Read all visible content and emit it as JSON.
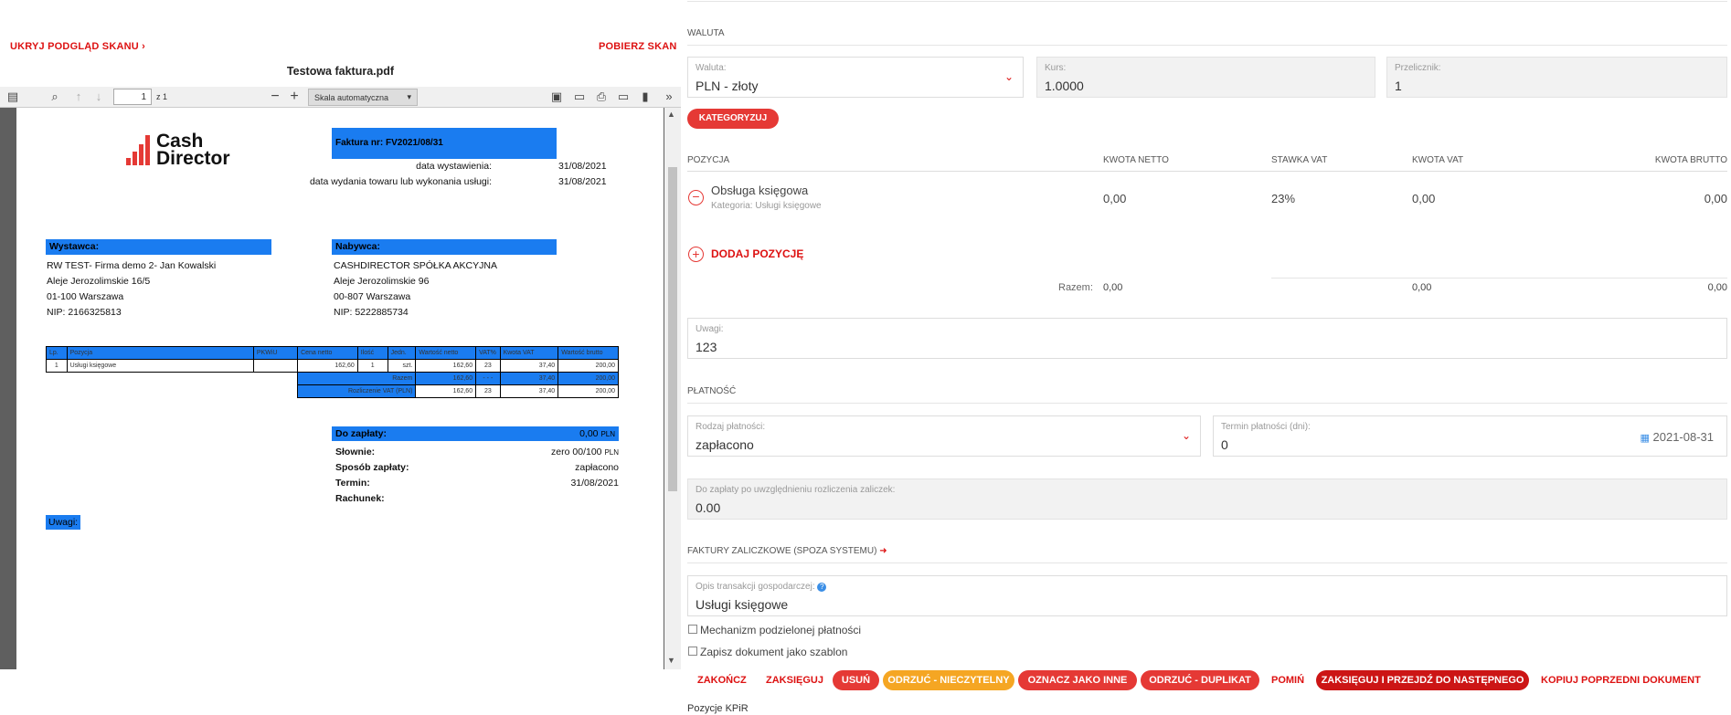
{
  "left": {
    "hide_scan": "UKRYJ PODGLĄD SKANU",
    "download_scan": "POBIERZ SKAN",
    "pdf_title": "Testowa faktura.pdf",
    "toolbar": {
      "page_current": "1",
      "page_total": "z 1",
      "zoom": "Skala automatyczna"
    }
  },
  "invoice": {
    "logo_line1": "Cash",
    "logo_line2": "Director",
    "number": "Faktura nr: FV2021/08/31",
    "issue_label": "data wystawienia:",
    "issue_date": "31/08/2021",
    "delivery_label": "data wydania towaru lub wykonania usługi:",
    "delivery_date": "31/08/2021",
    "seller_header": "Wystawca:",
    "seller": [
      "RW TEST- Firma demo 2- Jan Kowalski",
      "Aleje Jerozolimskie 16/5",
      "01-100 Warszawa",
      "NIP: 2166325813"
    ],
    "buyer_header": "Nabywca:",
    "buyer": [
      "CASHDIRECTOR SPÓŁKA AKCYJNA",
      "Aleje Jerozolimskie 96",
      "00-807 Warszawa",
      "NIP: 5222885734"
    ],
    "table_headers": [
      "Lp.",
      "Pozycja",
      "PKWiU",
      "Cena netto",
      "Ilość",
      "Jedn.",
      "Wartość netto",
      "VAT%",
      "Kwota VAT",
      "Wartość brutto"
    ],
    "row": [
      "1",
      "Usługi księgowe",
      "",
      "162,60",
      "1",
      "szt.",
      "162,60",
      "23",
      "37,40",
      "200,00"
    ],
    "sum_label": "Razem",
    "sum_row": [
      "162,60",
      "- - -",
      "37,40",
      "200,00"
    ],
    "vat_label": "Rozliczenie VAT (PLN)",
    "vat_row": [
      "162,60",
      "23",
      "37,40",
      "200,00"
    ],
    "pay_label": "Do zapłaty:",
    "pay_value": "0,00",
    "pay_currency": "PLN",
    "words_label": "Słownie:",
    "words_value": "zero 00/100",
    "words_currency": "PLN",
    "method_label": "Sposób zapłaty:",
    "method_value": "zapłacono",
    "term_label": "Termin:",
    "term_value": "31/08/2021",
    "account_label": "Rachunek:",
    "notes_label": "Uwagi:"
  },
  "right": {
    "currency_section": "WALUTA",
    "currency_label": "Waluta:",
    "currency_value": "PLN - złoty",
    "rate_label": "Kurs:",
    "rate_value": "1.0000",
    "conv_label": "Przelicznik:",
    "conv_value": "1",
    "categorize": "KATEGORYZUJ",
    "headers": {
      "position": "POZYCJA",
      "net": "KWOTA NETTO",
      "vat_rate": "STAWKA VAT",
      "vat": "KWOTA VAT",
      "gross": "KWOTA BRUTTO"
    },
    "item": {
      "name": "Obsługa księgowa",
      "category": "Kategoria: Usługi księgowe",
      "net": "0,00",
      "vat_rate": "23%",
      "vat": "0,00",
      "gross": "0,00"
    },
    "add_position": "DODAJ POZYCJĘ",
    "sum_label": "Razem:",
    "sum_net": "0,00",
    "sum_vat": "0,00",
    "sum_gross": "0,00",
    "notes_label": "Uwagi:",
    "notes_value": "123",
    "payment_section": "PŁATNOŚĆ",
    "payment_type_label": "Rodzaj płatności:",
    "payment_type_value": "zapłacono",
    "payment_term_label": "Termin płatności (dni):",
    "payment_term_value": "0",
    "payment_date": "2021-08-31",
    "to_pay_label": "Do zapłaty po uwzględnieniu rozliczenia zaliczek:",
    "to_pay_value": "0.00",
    "advance_section": "FAKTURY ZALICZKOWE (SPOZA SYSTEMU)",
    "desc_label": "Opis transakcji gospodarczej:",
    "desc_value": "Usługi księgowe",
    "split_payment": "Mechanizm podzielonej płatności",
    "save_template": "Zapisz dokument jako szablon",
    "buttons": {
      "finish": "ZAKOŃCZ",
      "post": "ZAKSIĘGUJ",
      "delete": "USUŃ",
      "reject_illegible": "ODRZUĆ - NIECZYTELNY",
      "mark_other": "OZNACZ JAKO INNE",
      "reject_duplicate": "ODRZUĆ - DUPLIKAT",
      "skip": "POMIŃ",
      "post_next": "ZAKSIĘGUJ I PRZEJDŹ DO NASTĘPNEGO",
      "copy_prev": "KOPIUJ POPRZEDNI DOKUMENT"
    },
    "kpir": "Pozycje KPiR"
  },
  "colors": {
    "accent_red": "#e53935",
    "orange": "#f5a623",
    "invoice_blue": "#1a7cf0"
  }
}
